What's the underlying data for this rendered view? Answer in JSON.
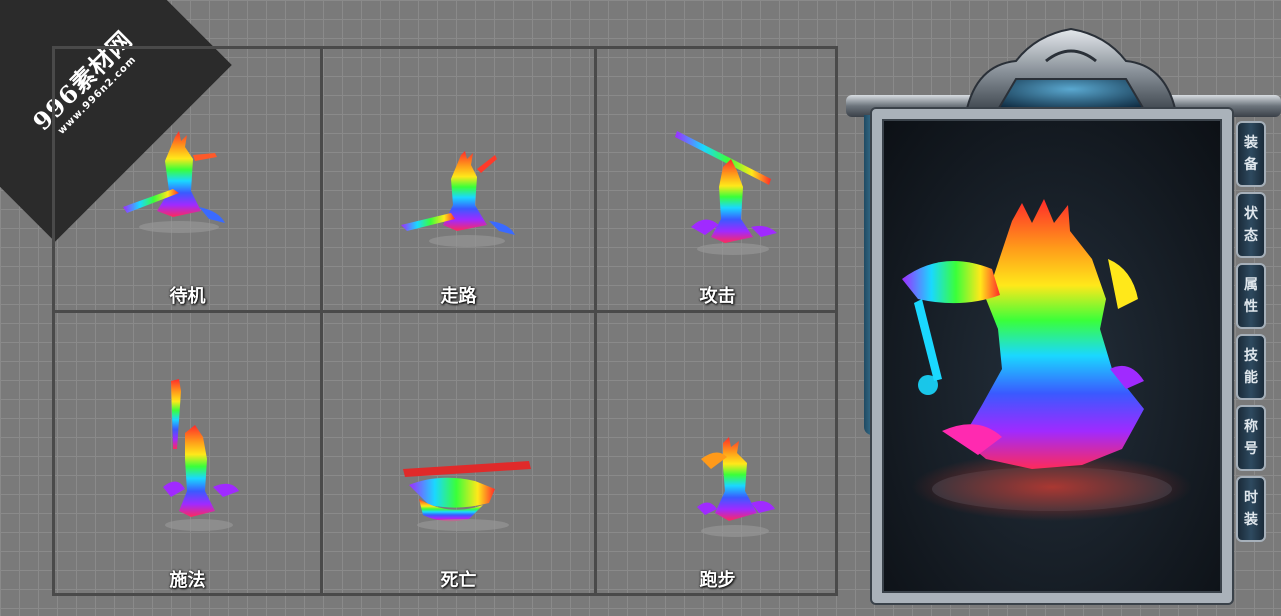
{
  "watermark": {
    "title": "996素材网",
    "url": "www.996n2.com"
  },
  "actions": [
    {
      "id": "idle",
      "label": "待机"
    },
    {
      "id": "walk",
      "label": "走路"
    },
    {
      "id": "attack",
      "label": "攻击"
    },
    {
      "id": "cast",
      "label": "施法"
    },
    {
      "id": "death",
      "label": "死亡"
    },
    {
      "id": "run",
      "label": "跑步"
    }
  ],
  "character_panel": {
    "tabs": [
      {
        "id": "equipment",
        "label_1": "装",
        "label_2": "备"
      },
      {
        "id": "status",
        "label_1": "状",
        "label_2": "态"
      },
      {
        "id": "attributes",
        "label_1": "属",
        "label_2": "性"
      },
      {
        "id": "skills",
        "label_1": "技",
        "label_2": "能"
      },
      {
        "id": "title",
        "label_1": "称",
        "label_2": "号"
      },
      {
        "id": "fashion",
        "label_1": "时",
        "label_2": "装"
      }
    ]
  },
  "colors": {
    "background": "#7a7a7a",
    "grid_border": "#4a4a4a",
    "panel_frame": "#aab2ba",
    "panel_bg": "#131920",
    "rainbow": [
      "#ff2a2a",
      "#ff9a1a",
      "#ffe81a",
      "#3aff3a",
      "#1ad8ff",
      "#3a5aff",
      "#a02aff",
      "#ff2ab0"
    ]
  }
}
